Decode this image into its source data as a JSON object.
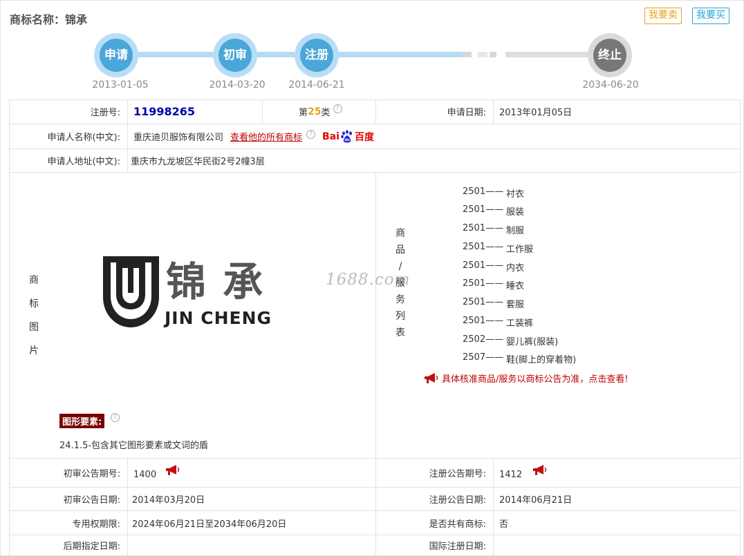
{
  "header": {
    "title": "商标名称：锦承",
    "sell_label": "我要卖",
    "buy_label": "我要买"
  },
  "timeline": {
    "steps": [
      {
        "label": "申请",
        "date": "2013-01-05"
      },
      {
        "label": "初审",
        "date": "2014-03-20"
      },
      {
        "label": "注册",
        "date": "2014-06-21"
      },
      {
        "label": "终止",
        "date": "2034-06-20"
      }
    ]
  },
  "info": {
    "reg_no_label": "注册号:",
    "reg_no": "11998265",
    "class_prefix": "第",
    "class_num": "25",
    "class_suffix": "类",
    "apply_date_label": "申请日期:",
    "apply_date": "2013年01月05日",
    "applicant_label": "申请人名称(中文):",
    "applicant": "重庆迪贝服饰有限公司",
    "view_all_link": "查看他的所有商标",
    "baidu_a": "Bai",
    "baidu_b": "百度",
    "address_label": "申请人地址(中文):",
    "address": "重庆市九龙坡区华民街2号2幢3层"
  },
  "image_section": {
    "vertical_label": [
      "商",
      "标",
      "图",
      "片"
    ],
    "logo_cn": "锦 承",
    "logo_en": "JIN CHENG",
    "watermark": "1688.com",
    "element_tag": "图形要素:",
    "element_desc": "24.1.5-包含其它图形要素或文词的盾"
  },
  "goods_section": {
    "vertical_label": [
      "商",
      "品",
      "/",
      "服",
      "务",
      "列",
      "表"
    ],
    "items": [
      {
        "code": "2501——",
        "name": "衬衣"
      },
      {
        "code": "2501——",
        "name": "服装"
      },
      {
        "code": "2501——",
        "name": "制服"
      },
      {
        "code": "2501——",
        "name": "工作服"
      },
      {
        "code": "2501——",
        "name": "内衣"
      },
      {
        "code": "2501——",
        "name": "睡衣"
      },
      {
        "code": "2501——",
        "name": "套服"
      },
      {
        "code": "2501——",
        "name": "工装裤"
      },
      {
        "code": "2502——",
        "name": "婴儿裤(服装)"
      },
      {
        "code": "2507——",
        "name": "鞋(脚上的穿着物)"
      }
    ],
    "notice": "具体核准商品/服务以商标公告为准，点击查看!"
  },
  "announce": {
    "prelim_no_label": "初审公告期号:",
    "prelim_no": "1400",
    "reg_no_label": "注册公告期号:",
    "reg_no": "1412",
    "prelim_date_label": "初审公告日期:",
    "prelim_date": "2014年03月20日",
    "reg_date_label": "注册公告日期:",
    "reg_date": "2014年06月21日",
    "exclusive_label": "专用权期限:",
    "exclusive": "2024年06月21日至2034年06月20日",
    "shared_label": "是否共有商标:",
    "shared": "否",
    "later_label": "后期指定日期:",
    "intl_label": "国际注册日期:"
  },
  "colors": {
    "timeline_active": "#4ba6d9",
    "timeline_end": "#777777",
    "reg_no": "#0000aa",
    "class_num": "#e8a21c",
    "link": "#c00000",
    "tag_bg": "#7a0000"
  }
}
